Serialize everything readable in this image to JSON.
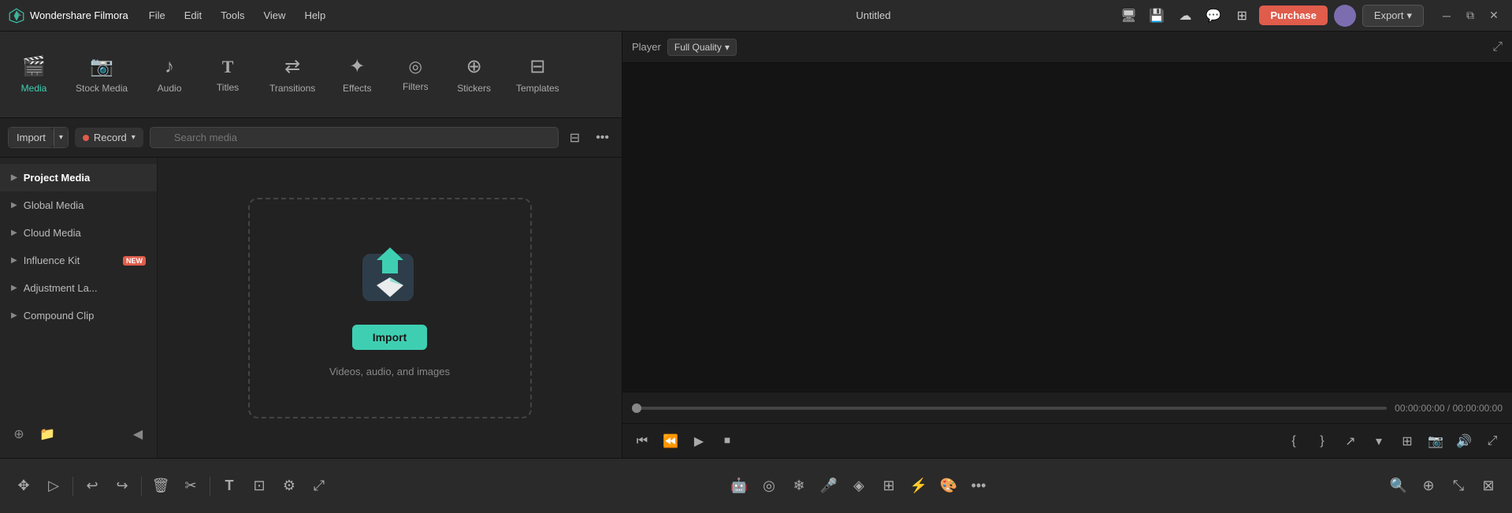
{
  "app": {
    "name": "Wondershare Filmora",
    "project_title": "Untitled"
  },
  "menu": {
    "items": [
      "File",
      "Edit",
      "Tools",
      "View",
      "Help"
    ]
  },
  "titlebar": {
    "purchase_label": "Purchase",
    "export_label": "Export"
  },
  "tabs": [
    {
      "id": "media",
      "label": "Media",
      "icon": "🎬",
      "active": true
    },
    {
      "id": "stock_media",
      "label": "Stock Media",
      "icon": "📷"
    },
    {
      "id": "audio",
      "label": "Audio",
      "icon": "🎵"
    },
    {
      "id": "titles",
      "label": "Titles",
      "icon": "T"
    },
    {
      "id": "transitions",
      "label": "Transitions",
      "icon": "↔"
    },
    {
      "id": "effects",
      "label": "Effects",
      "icon": "✨"
    },
    {
      "id": "filters",
      "label": "Filters",
      "icon": "🔘"
    },
    {
      "id": "stickers",
      "label": "Stickers",
      "icon": "⭐"
    },
    {
      "id": "templates",
      "label": "Templates",
      "icon": "⊞"
    }
  ],
  "toolbar": {
    "import_label": "Import",
    "record_label": "Record",
    "search_placeholder": "Search media"
  },
  "sidebar": {
    "items": [
      {
        "id": "project_media",
        "label": "Project Media",
        "active": true,
        "badge": null
      },
      {
        "id": "global_media",
        "label": "Global Media",
        "active": false,
        "badge": null
      },
      {
        "id": "cloud_media",
        "label": "Cloud Media",
        "active": false,
        "badge": null
      },
      {
        "id": "influence_kit",
        "label": "Influence Kit",
        "active": false,
        "badge": "NEW"
      },
      {
        "id": "adjustment_la",
        "label": "Adjustment La...",
        "active": false,
        "badge": null
      },
      {
        "id": "compound_clip",
        "label": "Compound Clip",
        "active": false,
        "badge": null
      }
    ]
  },
  "media_area": {
    "import_label": "Import",
    "hint_text": "Videos, audio, and images"
  },
  "player": {
    "label": "Player",
    "quality": "Full Quality",
    "time_current": "00:00:00:00",
    "time_total": "00:00:00:00"
  }
}
